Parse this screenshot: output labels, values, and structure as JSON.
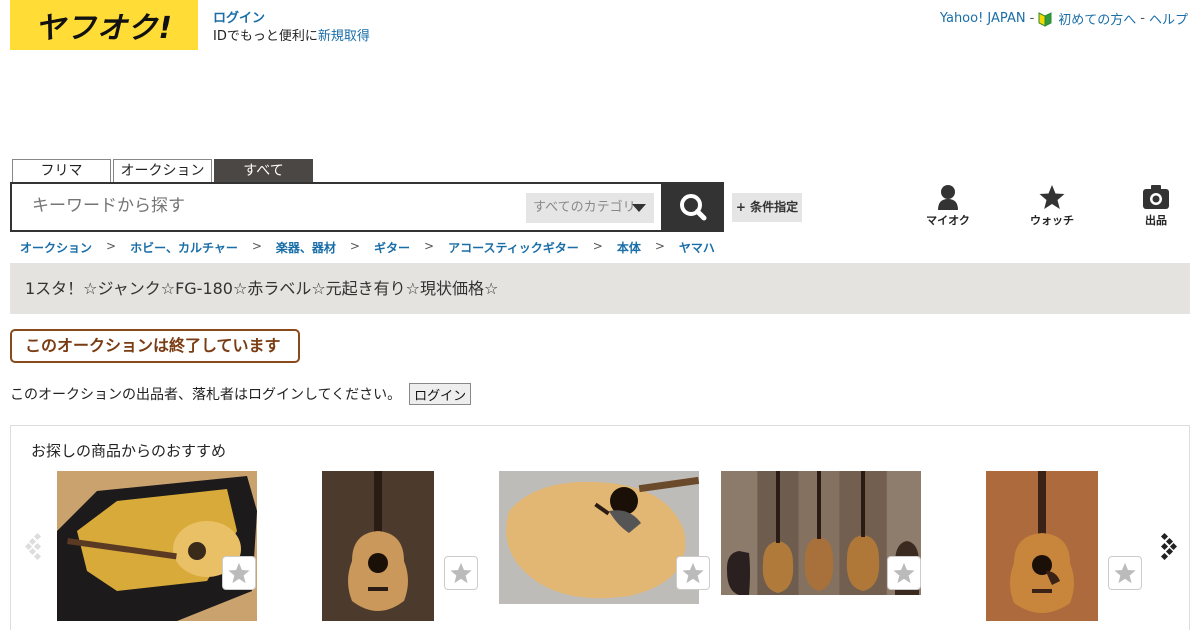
{
  "header": {
    "logo_text": "ヤフオク!",
    "login_link": "ログイン",
    "login_line_prefix": "IDでもっと便利に",
    "signup_link": "新規取得",
    "top_links": {
      "yahoo_japan": "Yahoo! JAPAN",
      "sep1": "-",
      "first_time": "初めての方へ",
      "sep2": "-",
      "help": "ヘルプ"
    }
  },
  "search": {
    "tabs": [
      {
        "label": "フリマ"
      },
      {
        "label": "オークション"
      },
      {
        "label": "すべて",
        "active": true
      }
    ],
    "placeholder": "キーワードから探す",
    "category": "すべてのカテゴリ",
    "condition_button": "+ 条件指定"
  },
  "nav_icons": [
    {
      "label": "マイオク",
      "icon": "person-icon"
    },
    {
      "label": "ウォッチ",
      "icon": "star-icon"
    },
    {
      "label": "出品",
      "icon": "camera-icon"
    }
  ],
  "breadcrumb": [
    "オークション",
    "ホビー、カルチャー",
    "楽器、器材",
    "ギター",
    "アコースティックギター",
    "本体",
    "ヤマハ"
  ],
  "breadcrumb_separator": ">",
  "item_title": "1スタ！☆ジャンク☆FG-180☆赤ラベル☆元起き有り☆現状価格☆",
  "ended_notice": "このオークションは終了しています",
  "login_prompt": {
    "message": "このオークションの出品者、落札者はログインしてください。",
    "button": "ログイン"
  },
  "recommendations": {
    "title": "お探しの商品からのおすすめ",
    "items": [
      {
        "image": "guitar-in-case-image"
      },
      {
        "image": "guitar-upright-image"
      },
      {
        "image": "guitar-body-closeup-image"
      },
      {
        "image": "guitar-collage-image"
      },
      {
        "image": "guitar-front-image"
      }
    ]
  },
  "colors": {
    "logo_bg": "#ffdc36",
    "link": "#1a6ea8",
    "ended_border": "#8a4a1c",
    "title_bg": "#e5e3df",
    "search_btn": "#333333"
  }
}
